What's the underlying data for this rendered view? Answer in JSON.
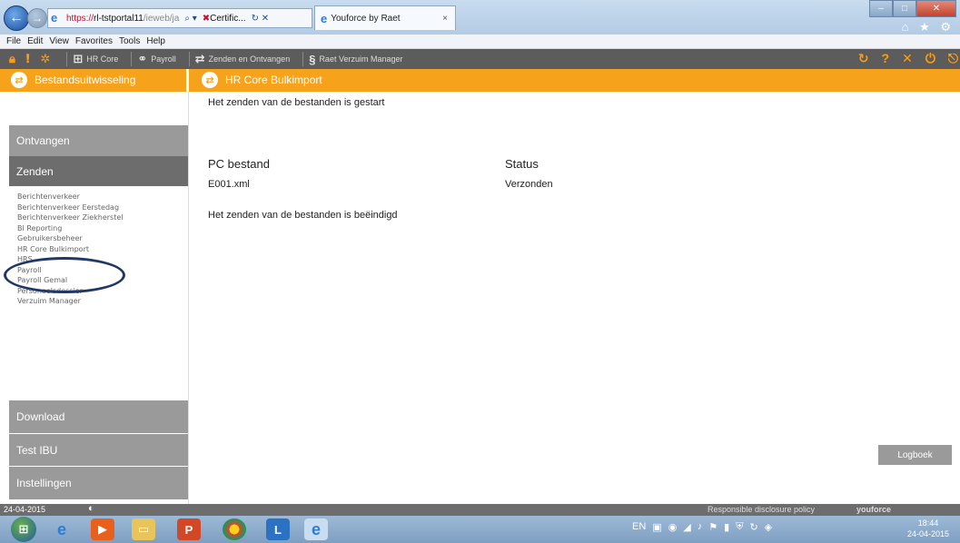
{
  "browser": {
    "address_scheme": "https://",
    "address_host": "rl-tstportal11",
    "address_path": "/ieweb/ja",
    "address_search_glyph": "⌕ ▾",
    "cert_label": "Certific...",
    "refresh_close": "↻ ✕",
    "tab_title": "Youforce by Raet",
    "tab_close": "×",
    "window_controls": {
      "minimize": "–",
      "maximize": "□",
      "close": "✕"
    },
    "tools_glyphs": "⌂ ★ ⚙"
  },
  "menu": [
    "File",
    "Edit",
    "View",
    "Favorites",
    "Tools",
    "Help"
  ],
  "app_toolbar": {
    "items": [
      {
        "label": "HR Core",
        "icon": "org-chart-icon"
      },
      {
        "label": "Payroll",
        "icon": "payroll-icon"
      },
      {
        "label": "Zenden en Ontvangen",
        "icon": "send-receive-icon"
      },
      {
        "label": "Raet Verzuim Manager",
        "icon": "verzuim-icon"
      }
    ]
  },
  "header": {
    "left_title": "Bestandsuitwisseling",
    "right_title": "HR Core Bulkimport"
  },
  "sidebar": {
    "ontvangen": "Ontvangen",
    "zenden": "Zenden",
    "links": [
      "Berichtenverkeer",
      "Berichtenverkeer Eerstedag",
      "Berichtenverkeer Ziekherstel",
      "BI Reporting",
      "Gebruikersbeheer",
      "HR Core Bulkimport",
      "HRS",
      "Payroll",
      "Payroll Gemal",
      "Personeelsdossier",
      "Verzuim Manager"
    ],
    "download": "Download",
    "test_ibu": "Test IBU",
    "instellingen": "Instellingen"
  },
  "main": {
    "message_start": "Het zenden van de bestanden is gestart",
    "columns": {
      "file": "PC bestand",
      "status": "Status"
    },
    "rows": [
      {
        "file": "E001.xml",
        "status": "Verzonden"
      }
    ],
    "message_end": "Het zenden van de bestanden is beëindigd",
    "logboek": "Logboek"
  },
  "status_bar": {
    "date": "24-04-2015",
    "disclosure": "Responsible disclosure policy",
    "brand": "youforce"
  },
  "taskbar": {
    "language": "EN",
    "time": "18:44",
    "date": "24-04-2015"
  },
  "colors": {
    "accent_orange": "#f7a21b",
    "toolbar_gray": "#5c5c5c",
    "nav_gray": "#9a9a9a",
    "nav_active": "#6d6d6d"
  }
}
